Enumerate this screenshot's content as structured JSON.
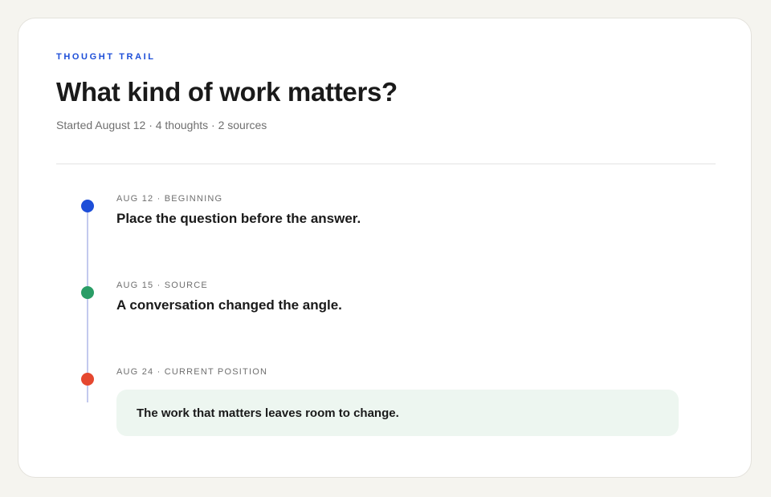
{
  "header": {
    "eyebrow": "THOUGHT TRAIL",
    "title": "What kind of work matters?",
    "meta": "Started August 12 · 4 thoughts · 2 sources"
  },
  "timeline": {
    "entries": [
      {
        "meta": "AUG 12 · BEGINNING",
        "text": "Place the question before the answer.",
        "color": "#1d4ed8"
      },
      {
        "meta": "AUG 15 · SOURCE",
        "text": "A conversation changed the angle.",
        "color": "#2a9d66"
      },
      {
        "meta": "AUG 24 · CURRENT POSITION",
        "text": "The work that matters leaves room to change.",
        "color": "#e5472f"
      }
    ]
  },
  "colors": {
    "accent": "#1d4ed8",
    "current_box": "#edf6f0",
    "rail": "#c3c9ee"
  }
}
